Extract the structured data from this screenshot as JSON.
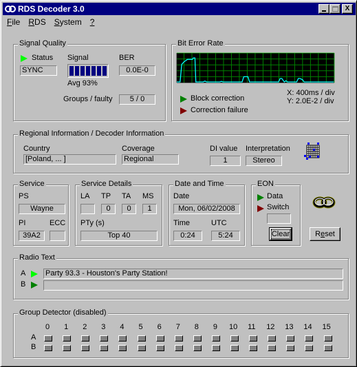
{
  "window": {
    "title": "RDS Decoder 3.0",
    "icon": "rds-app-icon",
    "controls": {
      "minimize": "_",
      "maximize": "□",
      "close": "X"
    }
  },
  "menu": [
    {
      "label": "File",
      "accel": "F"
    },
    {
      "label": "RDS",
      "accel": "R"
    },
    {
      "label": "System",
      "accel": "S"
    },
    {
      "label": "?",
      "accel": "?"
    }
  ],
  "signal_quality": {
    "title": "Signal Quality",
    "status_label": "Status",
    "status_value": "SYNC",
    "signal_label": "Signal",
    "signal_level_bars": 7,
    "signal_level_max": 7,
    "avg_text": "Avg  93%",
    "ber_label": "BER",
    "ber_value": "0.0E-0",
    "groups_label": "Groups / faulty",
    "groups_value": "5 / 0"
  },
  "bit_error_rate": {
    "title": "Bit Error Rate",
    "block_correction": "Block correction",
    "correction_failure": "Correction failure",
    "x_scale": "X: 400ms / div",
    "y_scale": "Y: 2.0E-2 / div",
    "colors": {
      "background": "#000000",
      "grid": "#008000",
      "trace": "#00ffff"
    }
  },
  "chart_data": {
    "type": "line",
    "title": "Bit Error Rate",
    "xlabel": "X: 400ms / div",
    "ylabel": "Y: 2.0E-2 / div",
    "x_divisions": 20,
    "y_divisions": 5,
    "ylim": [
      0,
      0.1
    ],
    "grid": true,
    "series": [
      {
        "name": "BER",
        "x": [
          0,
          0.4,
          0.6,
          0.9,
          1.3,
          1.9,
          2.0,
          2.2,
          2.3,
          2.5,
          3.2,
          3.4,
          3.6,
          5.2,
          5.4,
          5.6,
          7.9,
          8.1,
          8.3,
          8.6,
          8.8,
          9.0,
          12.3,
          12.5,
          12.7,
          13.0,
          13.2,
          13.4,
          14.5,
          14.7,
          14.9,
          15.2,
          15.4,
          15.6,
          19.0
        ],
        "y": [
          0,
          0,
          0.061,
          0.07,
          0.078,
          0.078,
          0.083,
          0.083,
          0,
          0,
          0,
          0.003,
          0,
          0,
          0.002,
          0,
          0,
          0.018,
          0.018,
          0.018,
          0,
          0,
          0,
          0.012,
          0.012,
          0,
          0.004,
          0,
          0,
          0.012,
          0.012,
          0.008,
          0,
          0,
          0
        ]
      }
    ]
  },
  "regional": {
    "title": "Regional Information / Decoder Information",
    "country_label": "Country",
    "country_value": "[Poland, ... ]",
    "coverage_label": "Coverage",
    "coverage_value": "Regional",
    "di_label": "DI value",
    "di_value": "1",
    "interp_label": "Interpretation",
    "interp_value": "Stereo",
    "icon": "decoder-grid-icon"
  },
  "service": {
    "title": "Service",
    "ps_label": "PS",
    "ps_value": "Wayne",
    "pi_label": "PI",
    "pi_value": "39A2",
    "ecc_label": "ECC",
    "ecc_value": ""
  },
  "service_details": {
    "title": "Service Details",
    "la_label": "LA",
    "la_value": "",
    "tp_label": "TP",
    "tp_value": "0",
    "ta_label": "TA",
    "ta_value": "0",
    "ms_label": "MS",
    "ms_value": "1",
    "pty_label": "PTy (s)",
    "pty_value": "Top 40"
  },
  "date_time": {
    "title": "Date and Time",
    "date_label": "Date",
    "date_value": "Mon, 06/02/2008",
    "time_label": "Time",
    "time_value": "0:24",
    "utc_label": "UTC",
    "utc_value": "5:24"
  },
  "eon": {
    "title": "EON",
    "data_label": "Data",
    "switch_label": "Switch",
    "switch_value": "",
    "clear_button": "Clear"
  },
  "reset_button": "Reset",
  "radio_text": {
    "title": "Radio Text",
    "a_label": "A",
    "a_value": "Party 93.3 - Houston's Party Station!",
    "b_label": "B",
    "b_value": ""
  },
  "group_detector": {
    "title": "Group Detector (disabled)",
    "columns": [
      "0",
      "1",
      "2",
      "3",
      "4",
      "5",
      "6",
      "7",
      "8",
      "9",
      "10",
      "11",
      "12",
      "13",
      "14",
      "15"
    ],
    "rows": [
      "A",
      "B"
    ]
  }
}
